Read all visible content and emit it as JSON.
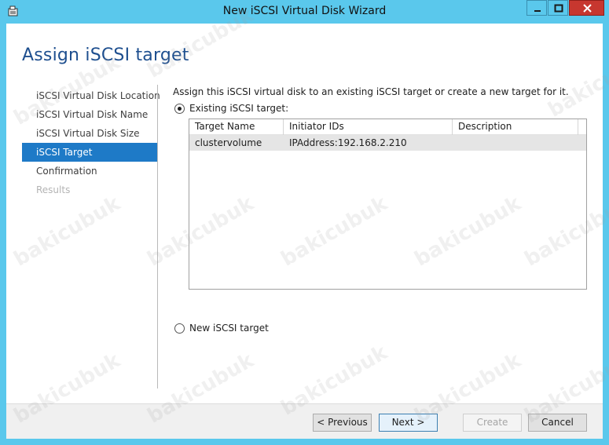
{
  "window": {
    "title": "New iSCSI Virtual Disk Wizard",
    "controls": [
      "minimize-icon",
      "maximize-icon",
      "close-icon"
    ],
    "app_icon": "wizard-icon"
  },
  "page": {
    "heading": "Assign iSCSI target"
  },
  "nav": {
    "items": [
      {
        "label": "iSCSI Virtual Disk Location",
        "state": "normal"
      },
      {
        "label": "iSCSI Virtual Disk Name",
        "state": "normal"
      },
      {
        "label": "iSCSI Virtual Disk Size",
        "state": "normal"
      },
      {
        "label": "iSCSI Target",
        "state": "active"
      },
      {
        "label": "Confirmation",
        "state": "normal"
      },
      {
        "label": "Results",
        "state": "disabled"
      }
    ]
  },
  "content": {
    "intro": "Assign this iSCSI virtual disk to an existing iSCSI target or create a new target for it.",
    "existing_option": {
      "label": "Existing iSCSI target:",
      "checked": true
    },
    "new_option": {
      "label": "New iSCSI target",
      "checked": false
    },
    "table": {
      "columns": [
        "Target Name",
        "Initiator IDs",
        "Description"
      ],
      "rows": [
        [
          "clustervolume",
          "IPAddress:192.168.2.210",
          ""
        ]
      ]
    }
  },
  "buttons": {
    "previous": "< Previous",
    "next": "Next >",
    "create": "Create",
    "cancel": "Cancel"
  },
  "watermark": "bakicubuk",
  "colors": {
    "titlebar": "#5ac8ec",
    "heading": "#1e4f8f",
    "nav_active": "#1e7ac7",
    "close_button": "#c7372f"
  }
}
